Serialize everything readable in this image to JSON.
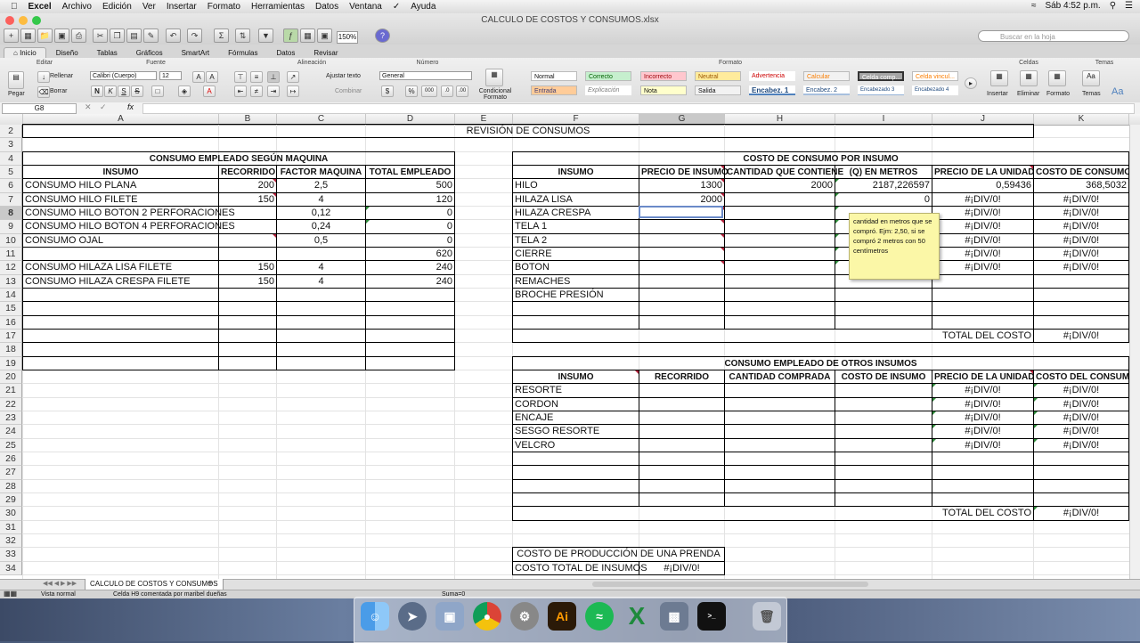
{
  "menubar": {
    "app": "Excel",
    "items": [
      "Archivo",
      "Edición",
      "Ver",
      "Insertar",
      "Formato",
      "Herramientas",
      "Datos",
      "Ventana",
      "Ayuda"
    ],
    "clock": "Sáb 4:52 p.m."
  },
  "window": {
    "title": "CALCULO DE COSTOS Y CONSUMOS.xlsx",
    "zoom": "150%",
    "search_placeholder": "Buscar en la hoja"
  },
  "ribbon": {
    "tabs": [
      "Inicio",
      "Diseño",
      "Tablas",
      "Gráficos",
      "SmartArt",
      "Fórmulas",
      "Datos",
      "Revisar"
    ],
    "groups": {
      "editar": "Editar",
      "fuente": "Fuente",
      "alineacion": "Alineación",
      "numero": "Número",
      "formato": "Formato",
      "celdas": "Celdas",
      "temas": "Temas"
    },
    "paste": "Pegar",
    "fill": "Rellenar",
    "clear": "Borrar",
    "font": "Calibri (Cuerpo)",
    "font_size": "12",
    "wrap": "Ajustar texto",
    "merge": "Combinar",
    "numfmt": "General",
    "conditional": "Condicional Formato",
    "styles": [
      "Normal",
      "Correcto",
      "Incorrecto",
      "Neutral",
      "Advertencia",
      "Calcular",
      "Celda comp...",
      "Celda vincul...",
      "Entrada",
      "Explicación",
      "Nota",
      "Salida",
      "Encabez. 1",
      "Encabez. 2",
      "Encabezado 3",
      "Encabezado 4"
    ],
    "insert": "Insertar",
    "delete": "Eliminar",
    "format": "Formato",
    "themes": "Temas"
  },
  "formula_bar": {
    "cell": "G8",
    "fx": "fx"
  },
  "columns": [
    "A",
    "B",
    "C",
    "D",
    "E",
    "F",
    "G",
    "H",
    "I",
    "J",
    "K"
  ],
  "rows": [
    "2",
    "3",
    "4",
    "5",
    "6",
    "7",
    "8",
    "9",
    "10",
    "11",
    "12",
    "13",
    "14",
    "15",
    "16",
    "17",
    "18",
    "19",
    "20",
    "21",
    "22",
    "23",
    "24",
    "25",
    "26",
    "27",
    "28",
    "29",
    "30",
    "31",
    "32",
    "33",
    "34"
  ],
  "sheet": {
    "revision": "REVISIÓN DE CONSUMOS",
    "left": {
      "title": "CONSUMO EMPLEADO SEGÚN MAQUINA",
      "headers": [
        "INSUMO",
        "RECORRIDO",
        "FACTOR MAQUINA",
        "TOTAL EMPLEADO"
      ],
      "rows": [
        [
          "CONSUMO HILO PLANA",
          "200",
          "2,5",
          "500"
        ],
        [
          "CONSUMO HILO FILETE",
          "150",
          "4",
          "120"
        ],
        [
          "CONSUMO HILO BOTON 2 PERFORACIONES",
          "",
          "0,12",
          "0"
        ],
        [
          "CONSUMO HILO BOTON 4 PERFORACIONES",
          "",
          "0,24",
          "0"
        ],
        [
          "CONSUMO OJAL",
          "",
          "0,5",
          "0"
        ],
        [
          "",
          "",
          "",
          "620"
        ],
        [
          "CONSUMO HILAZA LISA FILETE",
          "150",
          "4",
          "240"
        ],
        [
          "CONSUMO HILAZA CRESPA FILETE",
          "150",
          "4",
          "240"
        ]
      ]
    },
    "right": {
      "title": "COSTO DE CONSUMO POR INSUMO",
      "headers": [
        "INSUMO",
        "PRECIO DE INSUMO",
        "CANTIDAD QUE CONTIENE",
        "(Q) EN METROS",
        "PRECIO DE LA UNIDAD",
        "COSTO DE CONSUMO"
      ],
      "rows": [
        [
          "HILO",
          "1300",
          "2000",
          "2187,226597",
          "0,59436",
          "368,5032"
        ],
        [
          "HILAZA LISA",
          "2000",
          "",
          "0",
          "#¡DIV/0!",
          "#¡DIV/0!"
        ],
        [
          "HILAZA CRESPA",
          "",
          "",
          "",
          "#¡DIV/0!",
          "#¡DIV/0!"
        ],
        [
          "TELA 1",
          "",
          "",
          "",
          "#¡DIV/0!",
          "#¡DIV/0!"
        ],
        [
          "TELA 2",
          "",
          "",
          "",
          "#¡DIV/0!",
          "#¡DIV/0!"
        ],
        [
          "CIERRE",
          "",
          "",
          "",
          "#¡DIV/0!",
          "#¡DIV/0!"
        ],
        [
          "BOTON",
          "",
          "",
          "",
          "#¡DIV/0!",
          "#¡DIV/0!"
        ],
        [
          "REMACHES",
          "",
          "",
          "",
          "",
          ""
        ],
        [
          "BROCHE PRESIÓN",
          "",
          "",
          "",
          "",
          ""
        ]
      ],
      "total_label": "TOTAL DEL COSTO",
      "total_value": "#¡DIV/0!"
    },
    "others": {
      "title": "CONSUMO EMPLEADO DE OTROS INSUMOS",
      "headers": [
        "INSUMO",
        "RECORRIDO",
        "CANTIDAD COMPRADA",
        "COSTO DE INSUMO",
        "PRECIO DE LA UNIDAD",
        "COSTO DEL CONSUMO"
      ],
      "rows": [
        [
          "RESORTE",
          "#¡DIV/0!",
          "#¡DIV/0!"
        ],
        [
          "CORDON",
          "#¡DIV/0!",
          "#¡DIV/0!"
        ],
        [
          "ENCAJE",
          "#¡DIV/0!",
          "#¡DIV/0!"
        ],
        [
          "SESGO RESORTE",
          "#¡DIV/0!",
          "#¡DIV/0!"
        ],
        [
          "VELCRO",
          "#¡DIV/0!",
          "#¡DIV/0!"
        ]
      ],
      "total_label": "TOTAL DEL COSTO",
      "total_value": "#¡DIV/0!"
    },
    "production": {
      "title": "COSTO DE PRODUCCIÓN DE UNA PRENDA",
      "label": "COSTO TOTAL DE INSUMOS",
      "value": "#¡DIV/0!"
    },
    "note": "cantidad en metros que se compró. Ejm: 2,50, si se compró 2 metros con 50 centímetros"
  },
  "sheet_tab": "CALCULO DE COSTOS Y CONSUMOS",
  "status": {
    "view": "Vista normal",
    "comment": "Celda H9 comentada por maribel dueñas",
    "sum": "Suma=0"
  }
}
